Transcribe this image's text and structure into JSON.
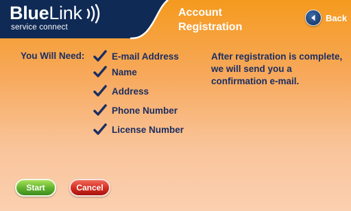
{
  "header": {
    "logo": {
      "brand_bold": "Blue",
      "brand_light": "Link",
      "tagline": "service connect",
      "waves_icon": "signal-waves-icon"
    },
    "title_line1": "Account",
    "title_line2": "Registration",
    "back": {
      "label": "Back",
      "icon": "arrow-left-icon"
    }
  },
  "requirements": {
    "label": "You Will Need:",
    "check_icon": "checkmark-icon",
    "items": [
      "E-mail Address",
      "Name",
      "Address",
      "Phone Number",
      "License Number"
    ]
  },
  "info_text": "After registration is complete, we will send you a confirmation e-mail.",
  "buttons": {
    "start": "Start",
    "cancel": "Cancel"
  },
  "colors": {
    "header_navy": "#0f2a55",
    "background_orange": "#f59a1e",
    "text_navy": "#1b2e62",
    "start_green": "#5fb12c",
    "cancel_red": "#d42a1e"
  }
}
